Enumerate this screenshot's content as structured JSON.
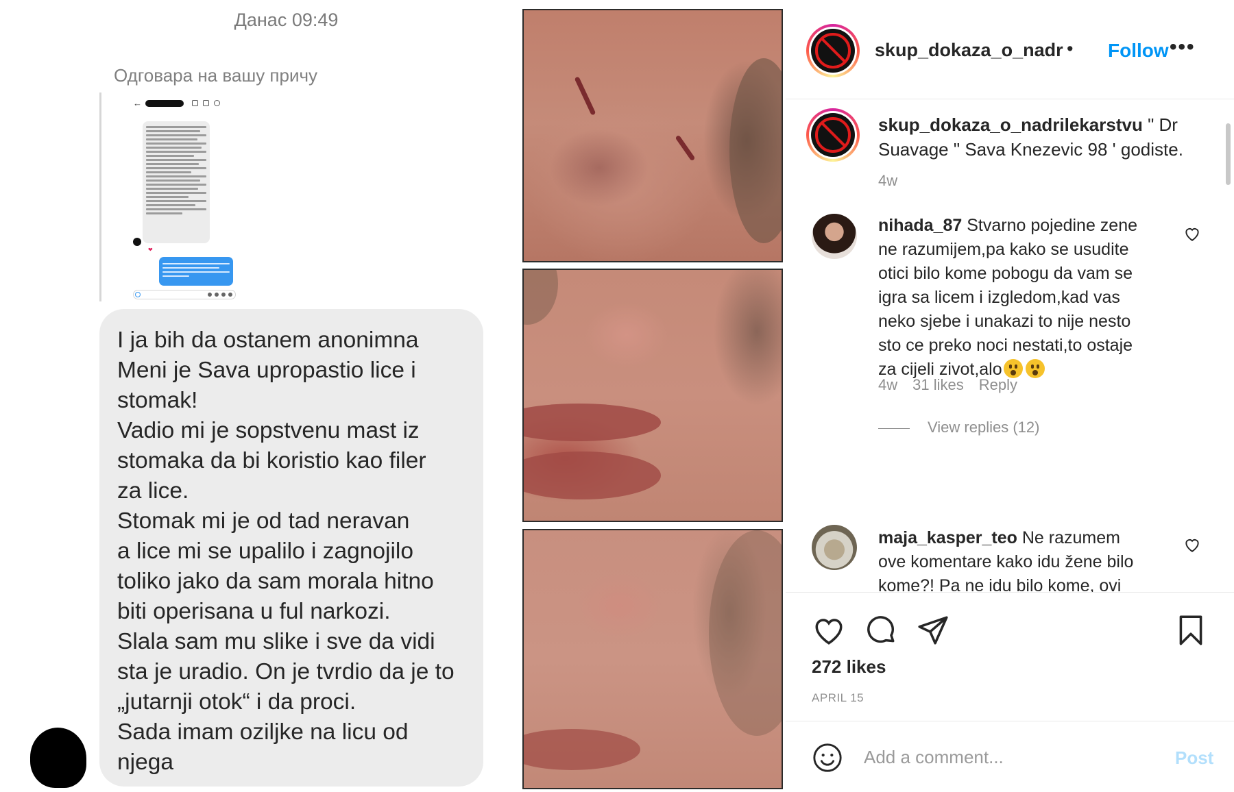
{
  "story_reply": {
    "timestamp": "Данас 09:49",
    "reply_label": "Одговара на вашу причу",
    "message_lines": [
      "I ja bih da ostanem anonimna",
      "Meni je Sava upropastio lice i",
      "stomak!",
      "Vadio mi je sopstvenu mast iz",
      "stomaka da bi koristio kao filer",
      "za lice.",
      "Stomak mi je od tad neravan",
      "a lice mi se upalilo i zagnojilo",
      "toliko jako da sam morala hitno",
      "biti operisana u ful narkozi.",
      "Slala sam mu slike i sve da vidi",
      "sta je uradio. On je tvrdio da je to",
      "„jutarnji otok“ i da proci.",
      "Sada imam oziljke na licu od",
      "njega"
    ]
  },
  "post": {
    "header": {
      "username": "skup_dokaza_o_nadrilekarstvu",
      "separator": "•",
      "follow_label": "Follow",
      "more_label": "•••"
    },
    "caption": {
      "username": "skup_dokaza_o_nadrilekarstvu",
      "text": " \" Dr Suavage \" Sava Knezevic 98 ' godiste.",
      "age": "4w"
    },
    "comments": [
      {
        "username": "nihada_87",
        "text": " Stvarno pojedine zene ne razumijem,pa kako se usudite otici bilo kome pobogu da vam se igra sa licem i izgledom,kad vas neko sjebe i unakazi to nije nesto sto ce preko noci nestati,to ostaje za cijeli zivot,alo",
        "emoji": "hushed-face-emoji",
        "age": "4w",
        "likes": "31 likes",
        "reply_label": "Reply",
        "view_replies": "View replies (12)"
      },
      {
        "username": "maja_kasper_teo",
        "text": " Ne razumem ove komentare kako idu žene bilo kome?! Pa ne idu bilo kome, ovi"
      }
    ],
    "likes": "272 likes",
    "date": "APRIL 15",
    "comment_placeholder": "Add a comment...",
    "post_label": "Post",
    "colors": {
      "link_blue": "#0095f6",
      "post_disabled": "#b2dffc",
      "secondary_text": "#8e8e8e",
      "bubble_gray": "#ececec"
    }
  }
}
